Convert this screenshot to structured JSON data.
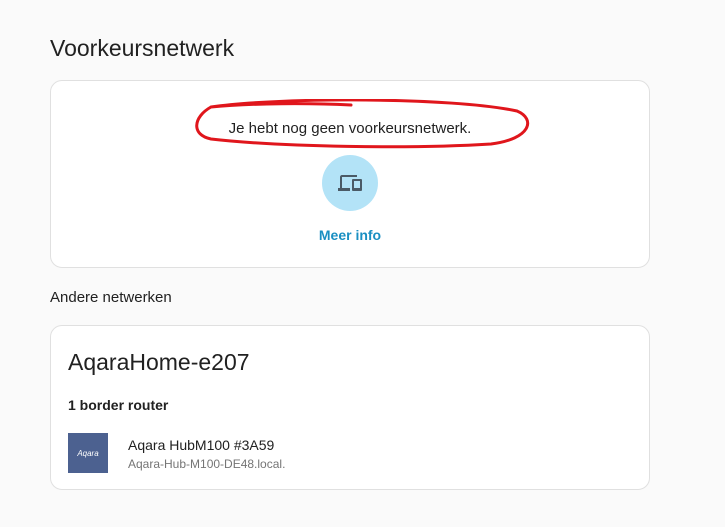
{
  "preferred": {
    "title": "Voorkeursnetwerk",
    "empty_text": "Je hebt nog geen voorkeursnetwerk.",
    "icon": "devices-icon",
    "more_info_label": "Meer info"
  },
  "other": {
    "title": "Andere netwerken",
    "networks": [
      {
        "name": "AqaraHome-e207",
        "router_count_label": "1 border router",
        "routers": [
          {
            "logo_text": "Aqara",
            "name": "Aqara HubM100 #3A59",
            "host": "Aqara-Hub-M100-DE48.local."
          }
        ]
      }
    ]
  },
  "colors": {
    "accent": "#1a8fc2",
    "icon_bg": "#b3e3f7",
    "annotation": "#e0161c",
    "logo_bg": "#4c6190"
  }
}
